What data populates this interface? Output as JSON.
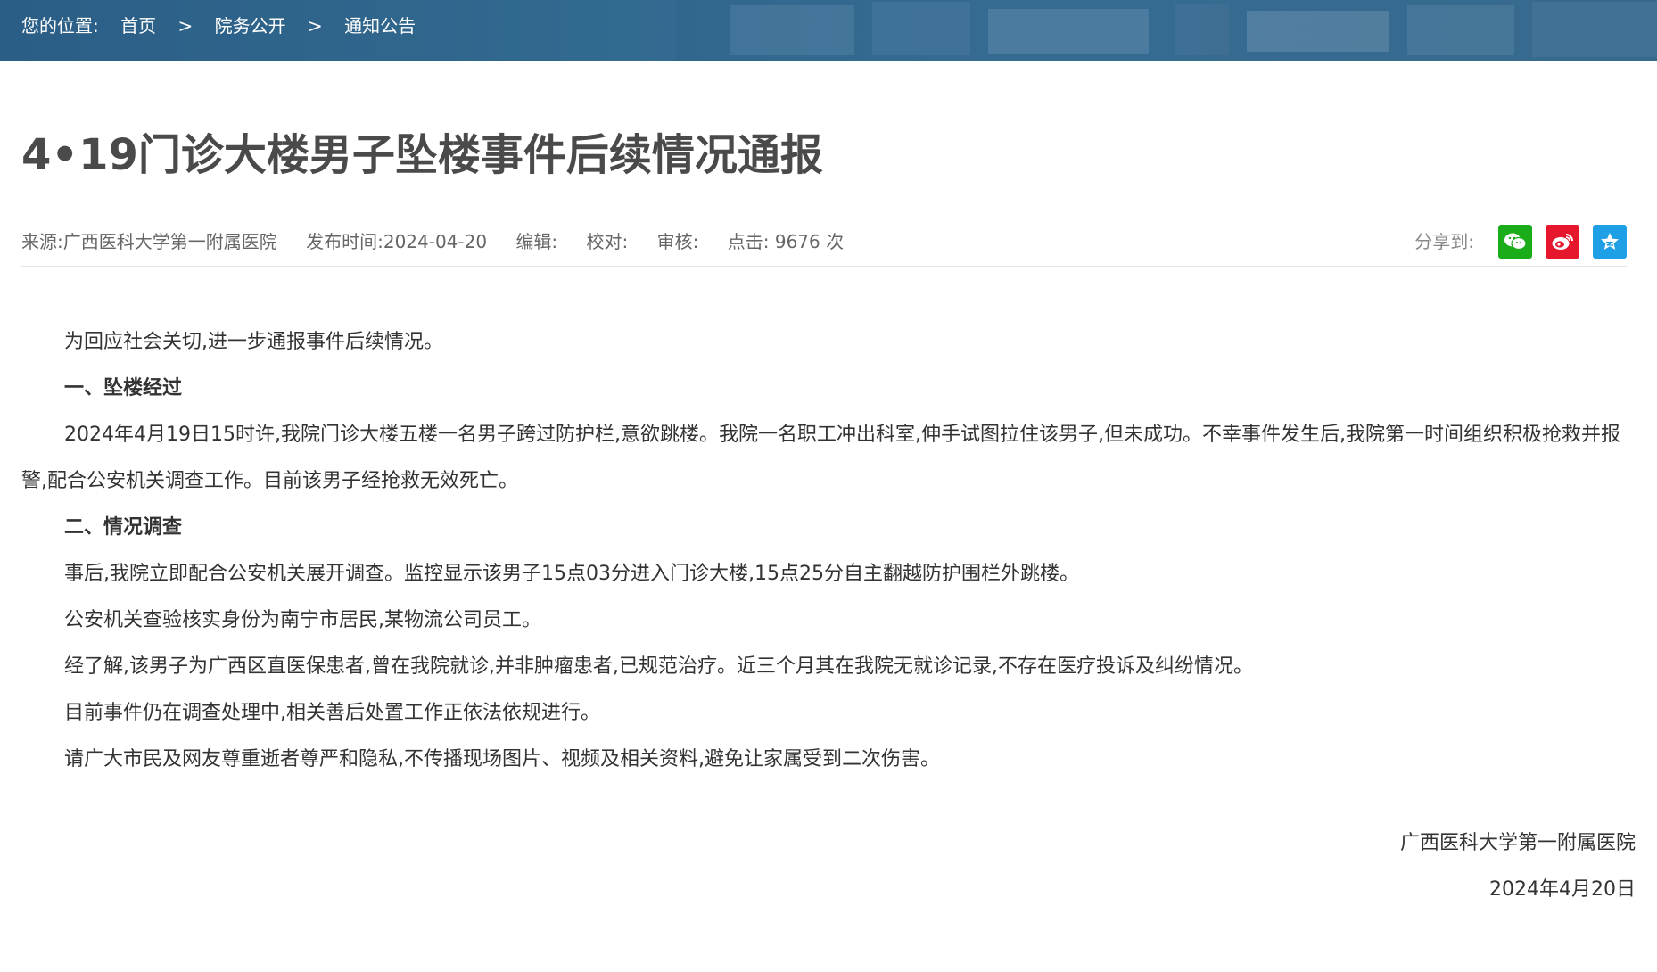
{
  "breadcrumb": {
    "prefix": "您的位置:",
    "items": [
      "首页",
      "院务公开",
      "通知公告"
    ],
    "separator": ">"
  },
  "article": {
    "title": "4•19门诊大楼男子坠楼事件后续情况通报",
    "meta": {
      "source": "来源:广西医科大学第一附属医院",
      "publish_time": "发布时间:2024-04-20",
      "editor": "编辑:",
      "proofreader": "校对:",
      "reviewer": "审核:",
      "clicks": "点击: 9676 次"
    },
    "share": {
      "label": "分享到:",
      "buttons": [
        {
          "name": "wechat",
          "color": "#1aad19"
        },
        {
          "name": "weibo",
          "color": "#e6162d"
        },
        {
          "name": "qzone",
          "color": "#1e9fe6"
        }
      ]
    },
    "paragraphs": [
      "为回应社会关切,进一步通报事件后续情况。",
      "一、坠楼经过",
      "2024年4月19日15时许,我院门诊大楼五楼一名男子跨过防护栏,意欲跳楼。我院一名职工冲出科室,伸手试图拉住该男子,但未成功。不幸事件发生后,我院第一时间组织积极抢救并报警,配合公安机关调查工作。目前该男子经抢救无效死亡。",
      "二、情况调查",
      "事后,我院立即配合公安机关展开调查。监控显示该男子15点03分进入门诊大楼,15点25分自主翻越防护围栏外跳楼。",
      "公安机关查验核实身份为南宁市居民,某物流公司员工。",
      "经了解,该男子为广西区直医保患者,曾在我院就诊,并非肿瘤患者,已规范治疗。近三个月其在我院无就诊记录,不存在医疗投诉及纠纷情况。",
      "目前事件仍在调查处理中,相关善后处置工作正依法依规进行。",
      "请广大市民及网友尊重逝者尊严和隐私,不传播现场图片、视频及相关资料,避免让家属受到二次伤害。"
    ],
    "signature": {
      "org": "广西医科大学第一附属医院",
      "date": "2024年4月20日"
    }
  },
  "colors": {
    "topbar": "#32698f",
    "title": "#4a4a4a",
    "meta": "#666666"
  }
}
